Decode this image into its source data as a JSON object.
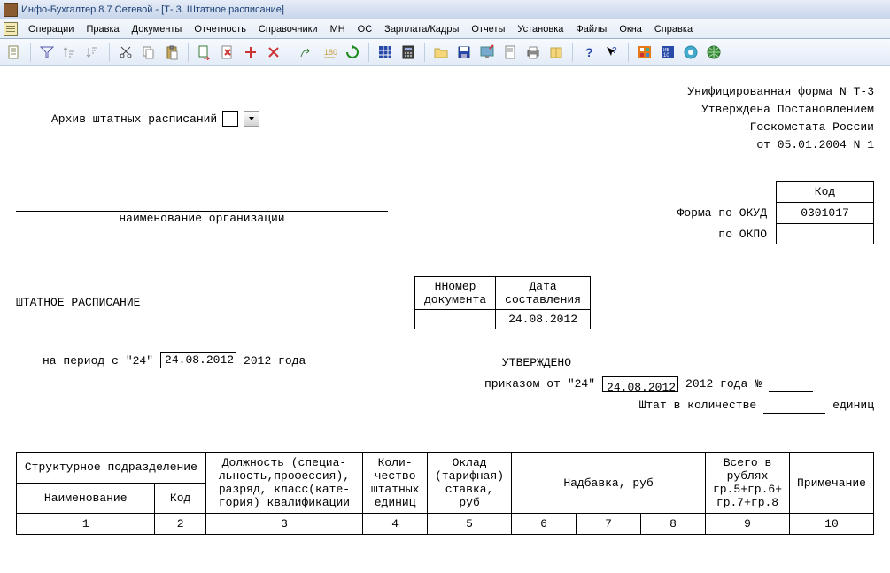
{
  "window": {
    "title": "Инфо-Бухгалтер 8.7 Сетевой - [Т- 3. Штатное расписание]"
  },
  "menu": {
    "items": [
      "Операции",
      "Правка",
      "Документы",
      "Отчетность",
      "Справочники",
      "МН",
      "ОС",
      "Зарплата/Кадры",
      "Отчеты",
      "Установка",
      "Файлы",
      "Окна",
      "Справка"
    ]
  },
  "toolbar_icons": [
    "doc-icon",
    "funnel-icon",
    "sort-asc-icon",
    "sort-desc-icon",
    "scissors-icon",
    "copy-icon",
    "paste-icon",
    "doc-arrow-icon",
    "doc-red-icon",
    "plus-icon",
    "cross-icon",
    "jump-icon",
    "text-width-icon",
    "refresh-icon",
    "grid-blue-icon",
    "calculator-icon",
    "folder-open-icon",
    "save-icon",
    "monitor-icon",
    "page-icon",
    "printer-icon",
    "book-icon",
    "help-icon",
    "pointer-help-icon",
    "orange-square-icon",
    "blue-box-icon",
    "blue-circle-icon",
    "globe-icon"
  ],
  "doc": {
    "archive_label": "Архив штатных расписаний",
    "form_header_l1": "Унифицированная форма N Т-3",
    "form_header_l2": "Утверждена Постановлением",
    "form_header_l3": "Госкомстата России",
    "form_header_l4": "от 05.01.2004 N 1",
    "code_hdr": "Код",
    "okud_label": "Форма по ОКУД",
    "okud": "0301017",
    "okpo_label": "по ОКПО",
    "okpo": "",
    "org_caption": "наименование организации",
    "title": "ШТАТНОЕ  РАСПИСАНИЕ",
    "numdate": {
      "num_hdr": "Номер документа",
      "date_hdr": "Дата составления",
      "num": "",
      "date": "24.08.2012"
    },
    "period_lbl_pre": "на   период с",
    "period_day": "\"24\"",
    "period_date": "24.08.2012",
    "period_year": "2012 года",
    "approved_lbl": "УТВЕРЖДЕНО",
    "order_lbl": "приказом от",
    "order_day": "\"24\"",
    "order_date": "24.08.2012",
    "order_year": "2012 года",
    "order_no_sym": "№",
    "order_no": "",
    "staff_lbl": "Штат в количестве",
    "staff_qty": "",
    "staff_units": "единиц",
    "tbl": {
      "struct": "Структурное подразделение",
      "name": "Наименование",
      "code": "Код",
      "position": "Должность (специа- льность,профессия), разряд, класс(кате- гория) квалификации",
      "qty": "Коли- чество штатных единиц",
      "salary": "Оклад (тарифная) ставка, руб",
      "allow": "Надбавка, руб",
      "total": "Всего в рублях гр.5+гр.6+ гр.7+гр.8",
      "note": "Примечание",
      "n1": "1",
      "n2": "2",
      "n3": "3",
      "n4": "4",
      "n5": "5",
      "n6": "6",
      "n7": "7",
      "n8": "8",
      "n9": "9",
      "n10": "10"
    }
  }
}
